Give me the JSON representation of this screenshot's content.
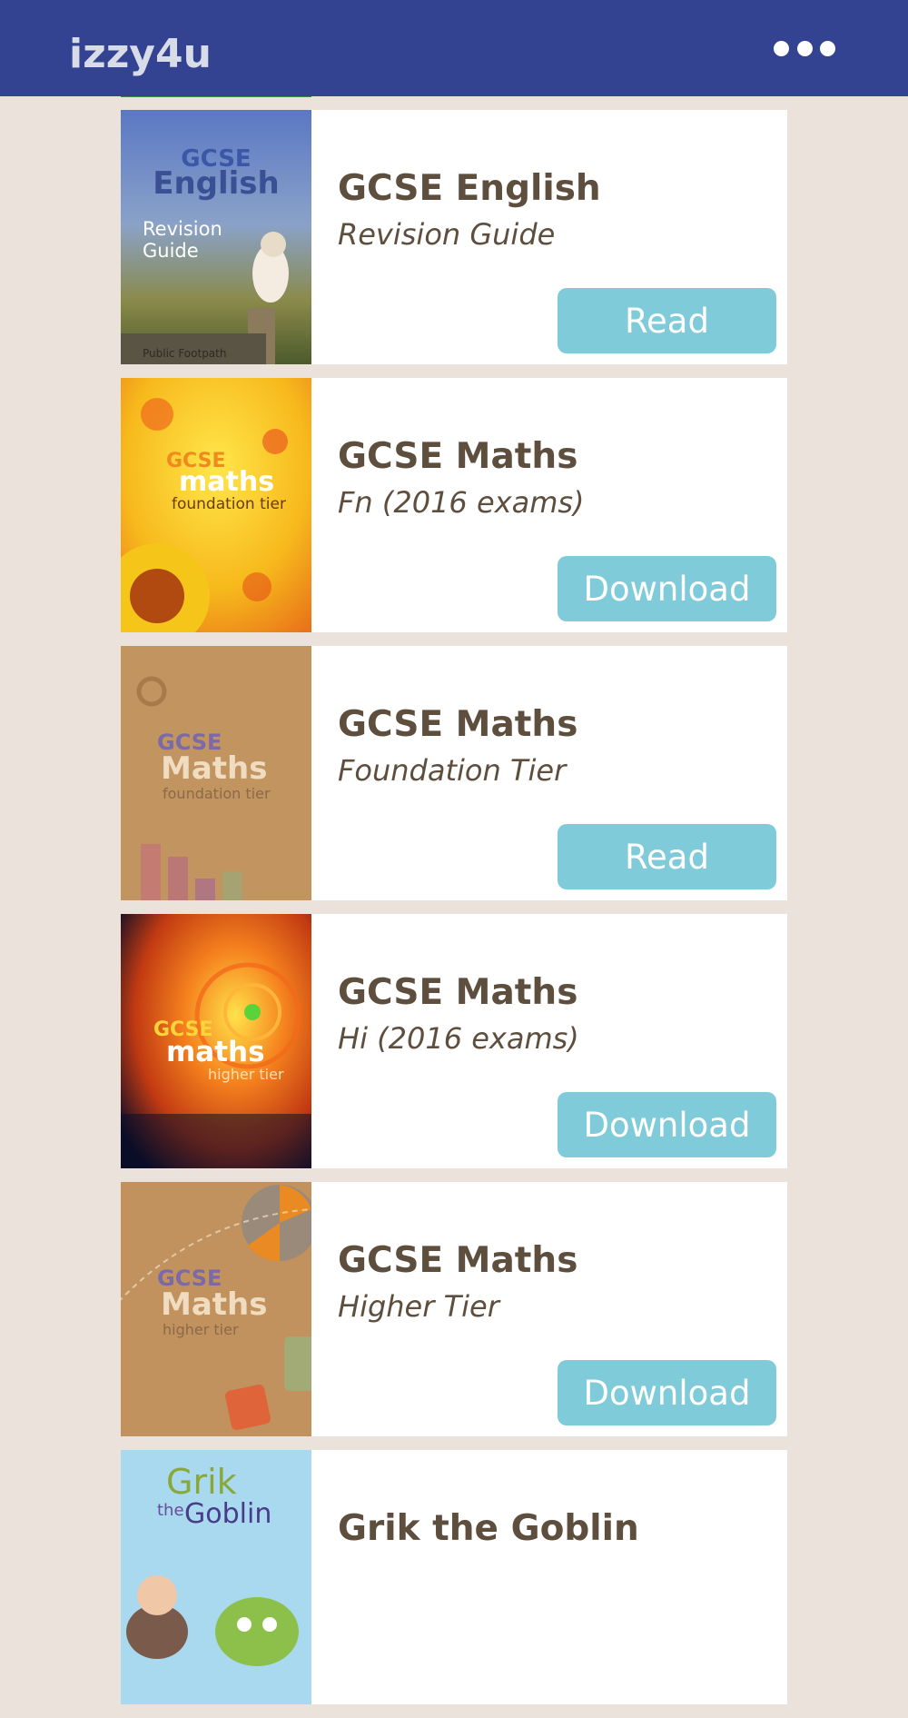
{
  "header": {
    "logo_text": "izzy4u",
    "menu_icon": "more-dots-icon",
    "background": "#334291"
  },
  "accent_color": "#80cbd9",
  "books": [
    {
      "title": "GCSE English",
      "subtitle": "Revision Guide",
      "action": "Read",
      "cover": {
        "line1": "GCSE",
        "line2": "English",
        "line3": "Revision",
        "line4": "Guide",
        "line5": "Public Footpath"
      }
    },
    {
      "title": "GCSE Maths",
      "subtitle": "Fn (2016 exams)",
      "action": "Download",
      "cover": {
        "line1": "GCSE",
        "line2": "maths",
        "line3": "foundation tier"
      }
    },
    {
      "title": "GCSE Maths",
      "subtitle": "Foundation Tier",
      "action": "Read",
      "cover": {
        "line1": "GCSE",
        "line2": "Maths",
        "line3": "foundation tier"
      }
    },
    {
      "title": "GCSE Maths",
      "subtitle": "Hi (2016 exams)",
      "action": "Download",
      "cover": {
        "line1": "GCSE",
        "line2": "maths",
        "line3": "higher tier"
      }
    },
    {
      "title": "GCSE Maths",
      "subtitle": "Higher Tier",
      "action": "Download",
      "cover": {
        "line1": "GCSE",
        "line2": "Maths",
        "line3": "higher tier"
      }
    },
    {
      "title": "Grik the Goblin",
      "subtitle": "",
      "action": "",
      "cover": {
        "line1": "Grik",
        "line2": "the",
        "line3": "Goblin"
      }
    }
  ]
}
